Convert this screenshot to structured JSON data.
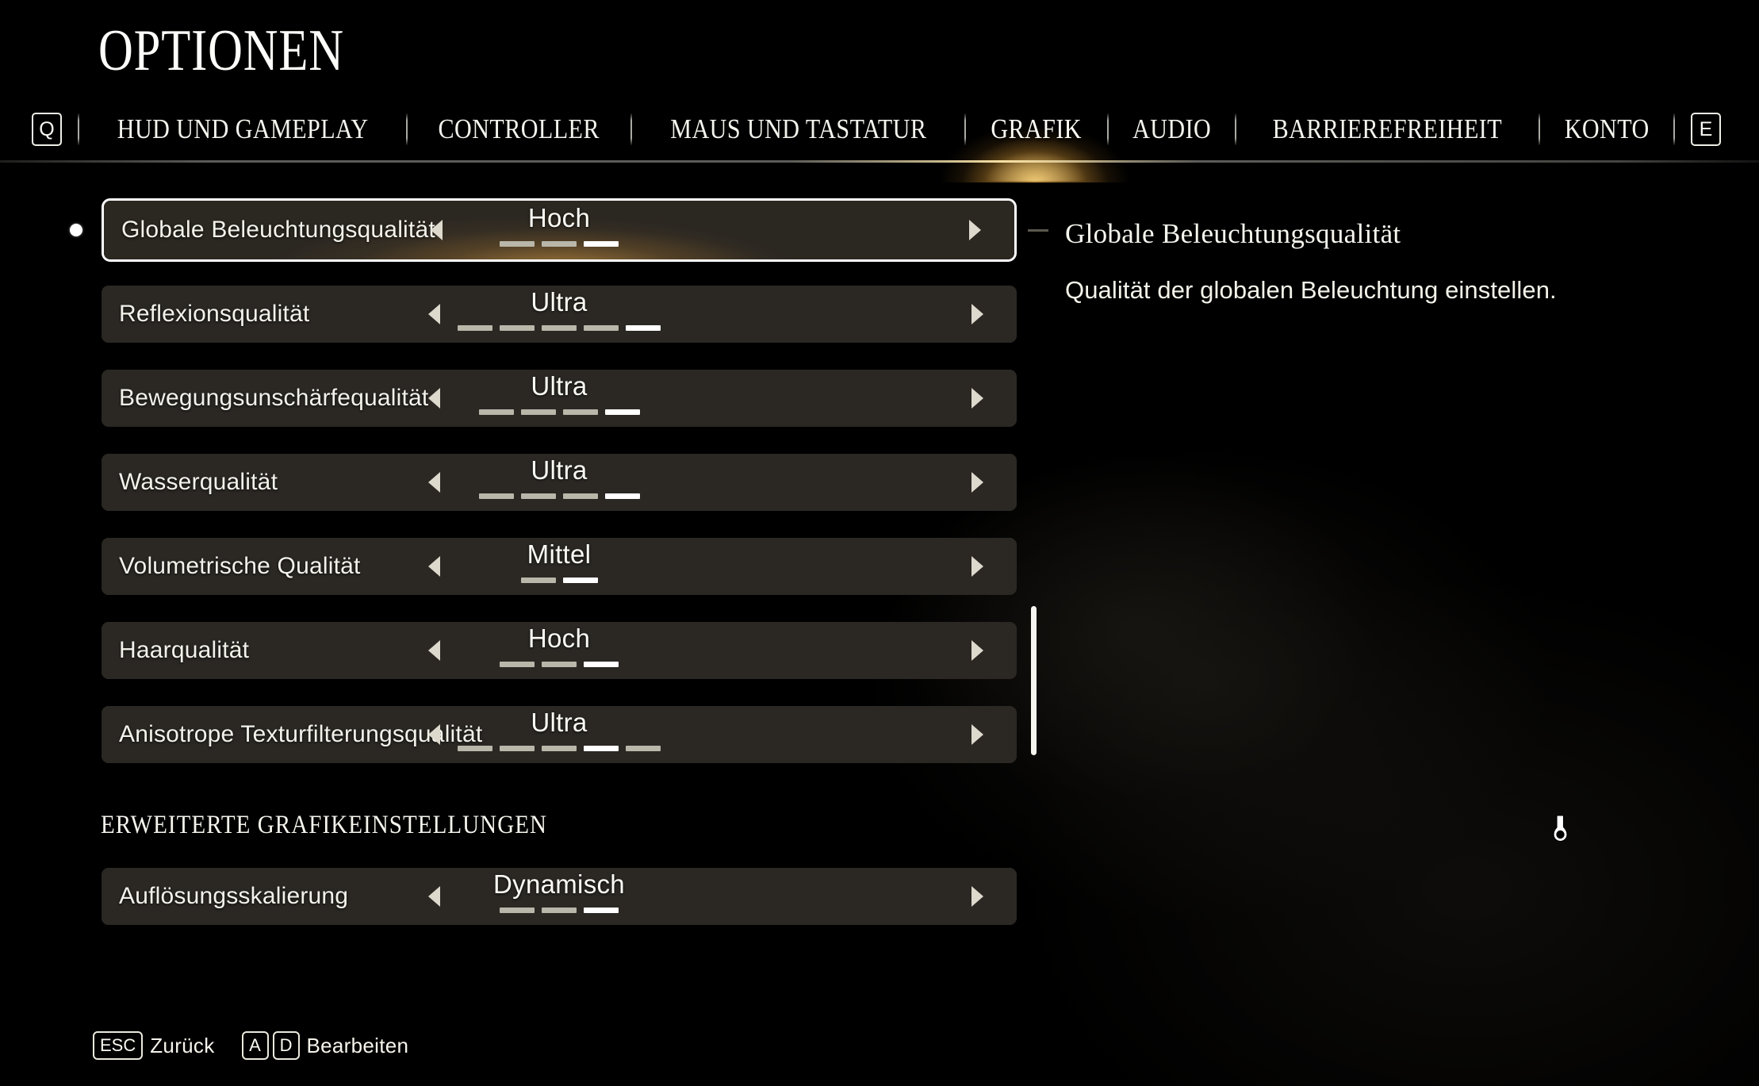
{
  "header": {
    "title": "OPTIONEN",
    "left_key": "Q",
    "right_key": "E",
    "tabs": [
      {
        "label": "HUD UND GAMEPLAY",
        "active": false
      },
      {
        "label": "CONTROLLER",
        "active": false
      },
      {
        "label": "MAUS UND TASTATUR",
        "active": false
      },
      {
        "label": "GRAFIK",
        "active": true
      },
      {
        "label": "AUDIO",
        "active": false
      },
      {
        "label": "BARRIEREFREIHEIT",
        "active": false
      },
      {
        "label": "KONTO",
        "active": false
      }
    ]
  },
  "settings": {
    "rows": [
      {
        "label": "Globale Beleuchtungsqualität",
        "value": "Hoch",
        "segments": 3,
        "active_segment": 3,
        "selected": true
      },
      {
        "label": "Reflexionsqualität",
        "value": "Ultra",
        "segments": 5,
        "active_segment": 5,
        "selected": false
      },
      {
        "label": "Bewegungsunschärfequalität",
        "value": "Ultra",
        "segments": 4,
        "active_segment": 4,
        "selected": false
      },
      {
        "label": "Wasserqualität",
        "value": "Ultra",
        "segments": 4,
        "active_segment": 4,
        "selected": false
      },
      {
        "label": "Volumetrische Qualität",
        "value": "Mittel",
        "segments": 2,
        "active_segment": 2,
        "selected": false
      },
      {
        "label": "Haarqualität",
        "value": "Hoch",
        "segments": 3,
        "active_segment": 3,
        "selected": false
      },
      {
        "label": "Anisotrope Texturfilterungsqualität",
        "value": "Ultra",
        "segments": 5,
        "active_segment": 4,
        "selected": false
      }
    ],
    "section_header": "ERWEITERTE GRAFIKEINSTELLUNGEN",
    "advanced_rows": [
      {
        "label": "Auflösungsskalierung",
        "value": "Dynamisch",
        "segments": 3,
        "active_segment": 3,
        "selected": false
      }
    ]
  },
  "detail": {
    "title": "Globale Beleuchtungsqualität",
    "description": "Qualität der globalen Beleuchtung einstellen."
  },
  "footer": {
    "hints": [
      {
        "keys": [
          "ESC"
        ],
        "label": "Zurück"
      },
      {
        "keys": [
          "A",
          "D"
        ],
        "label": "Bearbeiten"
      }
    ]
  },
  "colors": {
    "accent_gold": "#ffc65c",
    "row_bg": "#2b2824",
    "text_primary": "#f6f5ee",
    "segment_off": "#b9b7a9",
    "segment_on": "#ffffff"
  }
}
